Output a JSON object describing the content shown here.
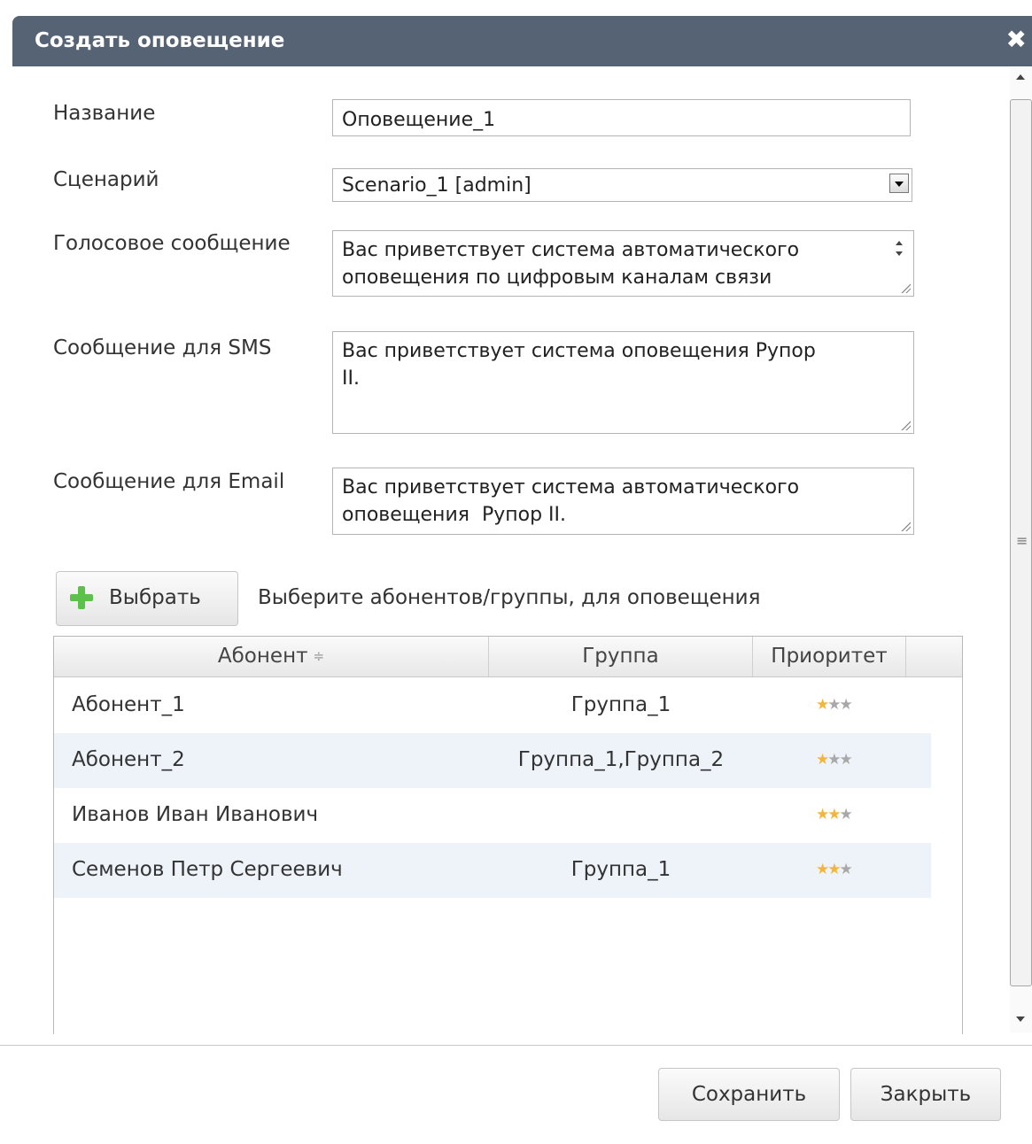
{
  "dialog": {
    "title": "Создать оповещение",
    "close_symbol": "✖"
  },
  "form": {
    "name_label": "Название",
    "name_value": "Оповещение_1",
    "scenario_label": "Сценарий",
    "scenario_value": "Scenario_1 [admin]",
    "voice_label": "Голосовое сообщение",
    "voice_value": "Вас приветствует система автоматического\nоповещения по цифровым каналам связи",
    "sms_label": "Сообщение для SMS",
    "sms_value": "Вас приветствует система оповещения Рупор\nII.",
    "email_label": "Сообщение для Email",
    "email_value": "Вас приветствует система автоматического\nоповещения  Рупор II."
  },
  "select": {
    "button_label": "Выбрать",
    "hint": "Выберите абонентов/группы, для оповещения"
  },
  "grid": {
    "columns": [
      "Абонент",
      "Группа",
      "Приоритет"
    ],
    "sort_symbol": "≑",
    "rows": [
      {
        "subscriber": "Абонент_1",
        "group": "Группа_1",
        "priority": 1
      },
      {
        "subscriber": "Абонент_2",
        "group": "Группа_1,Группа_2",
        "priority": 1
      },
      {
        "subscriber": "Иванов Иван Иванович",
        "group": "",
        "priority": 2
      },
      {
        "subscriber": "Семенов Петр Сергеевич",
        "group": "Группа_1",
        "priority": 2
      }
    ],
    "max_priority": 3
  },
  "footer": {
    "save_label": "Сохранить",
    "close_label": "Закрыть"
  },
  "colors": {
    "titlebar": "#556375",
    "row_alt": "#eef3f9",
    "star_on": "#f4b63a",
    "star_off": "#a8a8a8",
    "plus_icon": "#5cc14a"
  }
}
